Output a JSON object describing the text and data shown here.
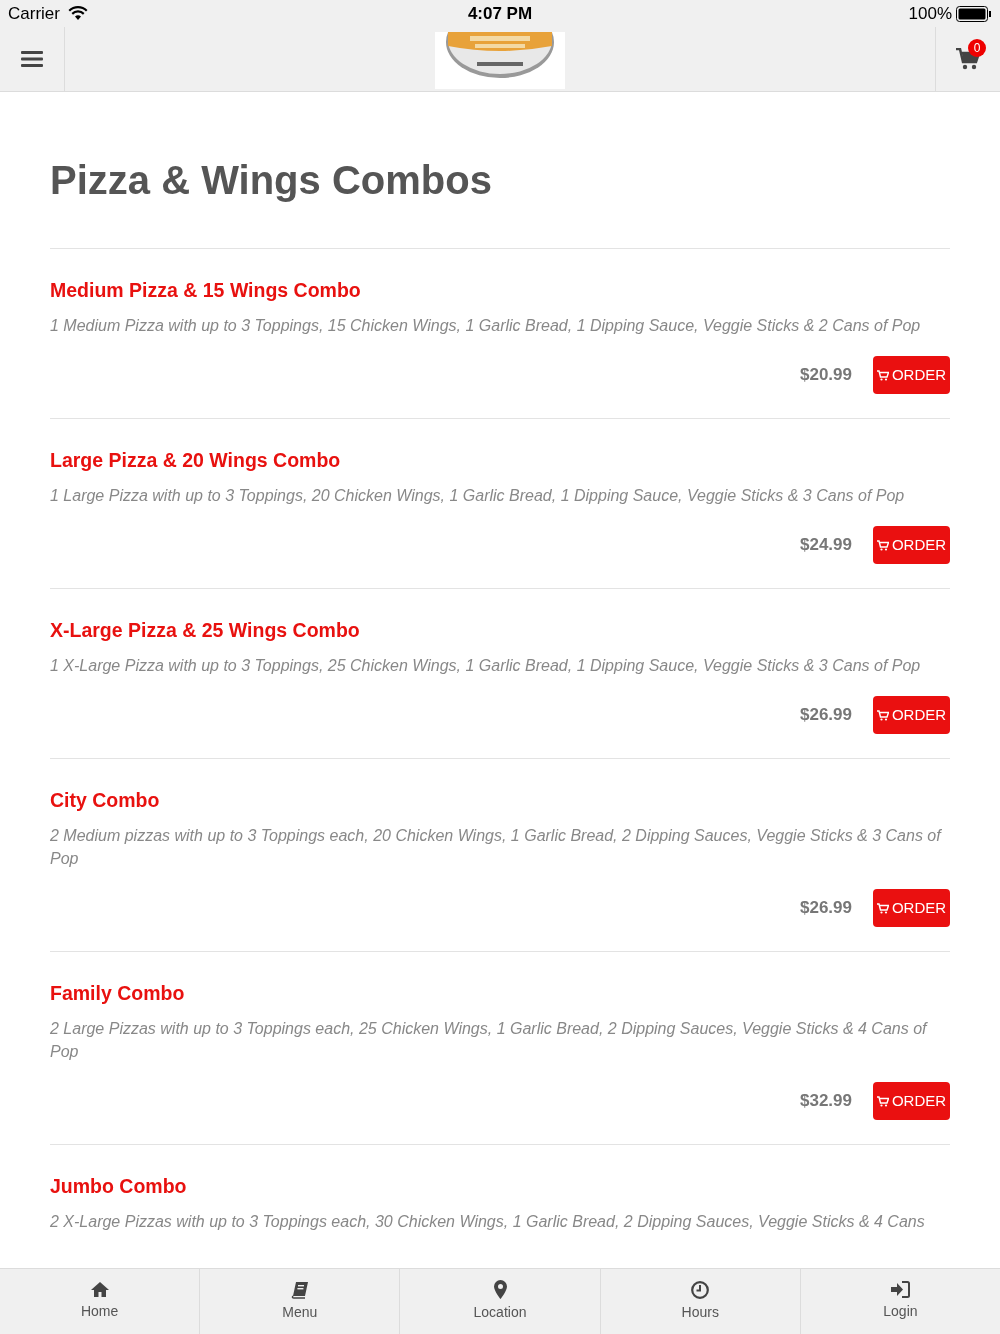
{
  "status_bar": {
    "carrier": "Carrier",
    "time": "4:07 PM",
    "battery": "100%"
  },
  "nav": {
    "cart_count": "0"
  },
  "page_title": "Pizza & Wings Combos",
  "items": [
    {
      "name": "Medium Pizza & 15 Wings Combo",
      "description": "1 Medium Pizza with up to 3 Toppings, 15 Chicken Wings, 1 Garlic Bread, 1 Dipping Sauce, Veggie Sticks & 2 Cans of Pop",
      "price": "$20.99",
      "button": "ORDER"
    },
    {
      "name": "Large Pizza & 20 Wings Combo",
      "description": "1 Large Pizza with up to 3 Toppings, 20 Chicken Wings, 1 Garlic Bread, 1 Dipping Sauce, Veggie Sticks & 3 Cans of Pop",
      "price": "$24.99",
      "button": "ORDER"
    },
    {
      "name": "X-Large Pizza & 25 Wings Combo",
      "description": "1 X-Large Pizza with up to 3 Toppings, 25 Chicken Wings, 1 Garlic Bread, 1 Dipping Sauce, Veggie Sticks & 3 Cans of Pop",
      "price": "$26.99",
      "button": "ORDER"
    },
    {
      "name": "City Combo",
      "description": "2 Medium pizzas with up to 3 Toppings each, 20 Chicken Wings, 1 Garlic Bread, 2 Dipping Sauces, Veggie Sticks & 3 Cans of Pop",
      "price": "$26.99",
      "button": "ORDER"
    },
    {
      "name": "Family Combo",
      "description": "2 Large Pizzas with up to 3 Toppings each, 25 Chicken Wings, 1 Garlic Bread, 2 Dipping Sauces, Veggie Sticks & 4 Cans of Pop",
      "price": "$32.99",
      "button": "ORDER"
    },
    {
      "name": "Jumbo Combo",
      "description": "2 X-Large Pizzas with up to 3 Toppings each, 30 Chicken Wings, 1 Garlic Bread, 2 Dipping Sauces, Veggie Sticks & 4 Cans"
    }
  ],
  "tab_bar": [
    {
      "kind": "home",
      "label": "Home"
    },
    {
      "kind": "menu",
      "label": "Menu"
    },
    {
      "kind": "location",
      "label": "Location"
    },
    {
      "kind": "hours",
      "label": "Hours"
    },
    {
      "kind": "login",
      "label": "Login"
    }
  ]
}
